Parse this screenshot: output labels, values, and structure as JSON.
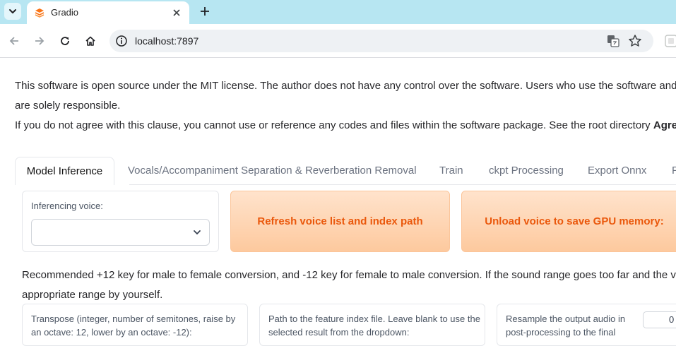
{
  "browser": {
    "tab_title": "Gradio",
    "url": "localhost:7897"
  },
  "notice": {
    "line1": "This software is open source under the MIT license. The author does not have any control over the software. Users who use the software and d",
    "line2": "are solely responsible.",
    "line3_prefix": "If you do not agree with this clause, you cannot use or reference any codes and files within the software package. See the root directory ",
    "line3_bold": "Agree"
  },
  "tabs": [
    {
      "label": "Model Inference",
      "active": true
    },
    {
      "label": "Vocals/Accompaniment Separation & Reverberation Removal",
      "active": false
    },
    {
      "label": "Train",
      "active": false
    },
    {
      "label": "ckpt Processing",
      "active": false
    },
    {
      "label": "Export Onnx",
      "active": false
    },
    {
      "label": "F",
      "active": false
    }
  ],
  "inference": {
    "voice_label": "Inferencing voice:",
    "voice_value": "",
    "refresh_button": "Refresh voice list and index path",
    "unload_button": "Unload voice to save GPU memory:",
    "recommendation_line1": "Recommended +12 key for male to female conversion, and -12 key for female to male conversion. If the sound range goes too far and the voi",
    "recommendation_line2": "appropriate range by yourself.",
    "transpose_label_1": "Transpose (integer, number of semitones, raise by",
    "transpose_label_2": "an octave: 12, lower by an octave: -12):",
    "index_label_1": "Path to the feature index file. Leave blank to use the",
    "index_label_2": "selected result from the dropdown:",
    "resample_label_1": "Resample the output audio in",
    "resample_label_2": "post-processing to the final",
    "resample_value": "0"
  },
  "colors": {
    "tabstrip": "#b7e6f2",
    "accent_orange": "#ea580c",
    "button_orange_light": "#ffe3cc",
    "button_orange_dark": "#fdc99e"
  }
}
